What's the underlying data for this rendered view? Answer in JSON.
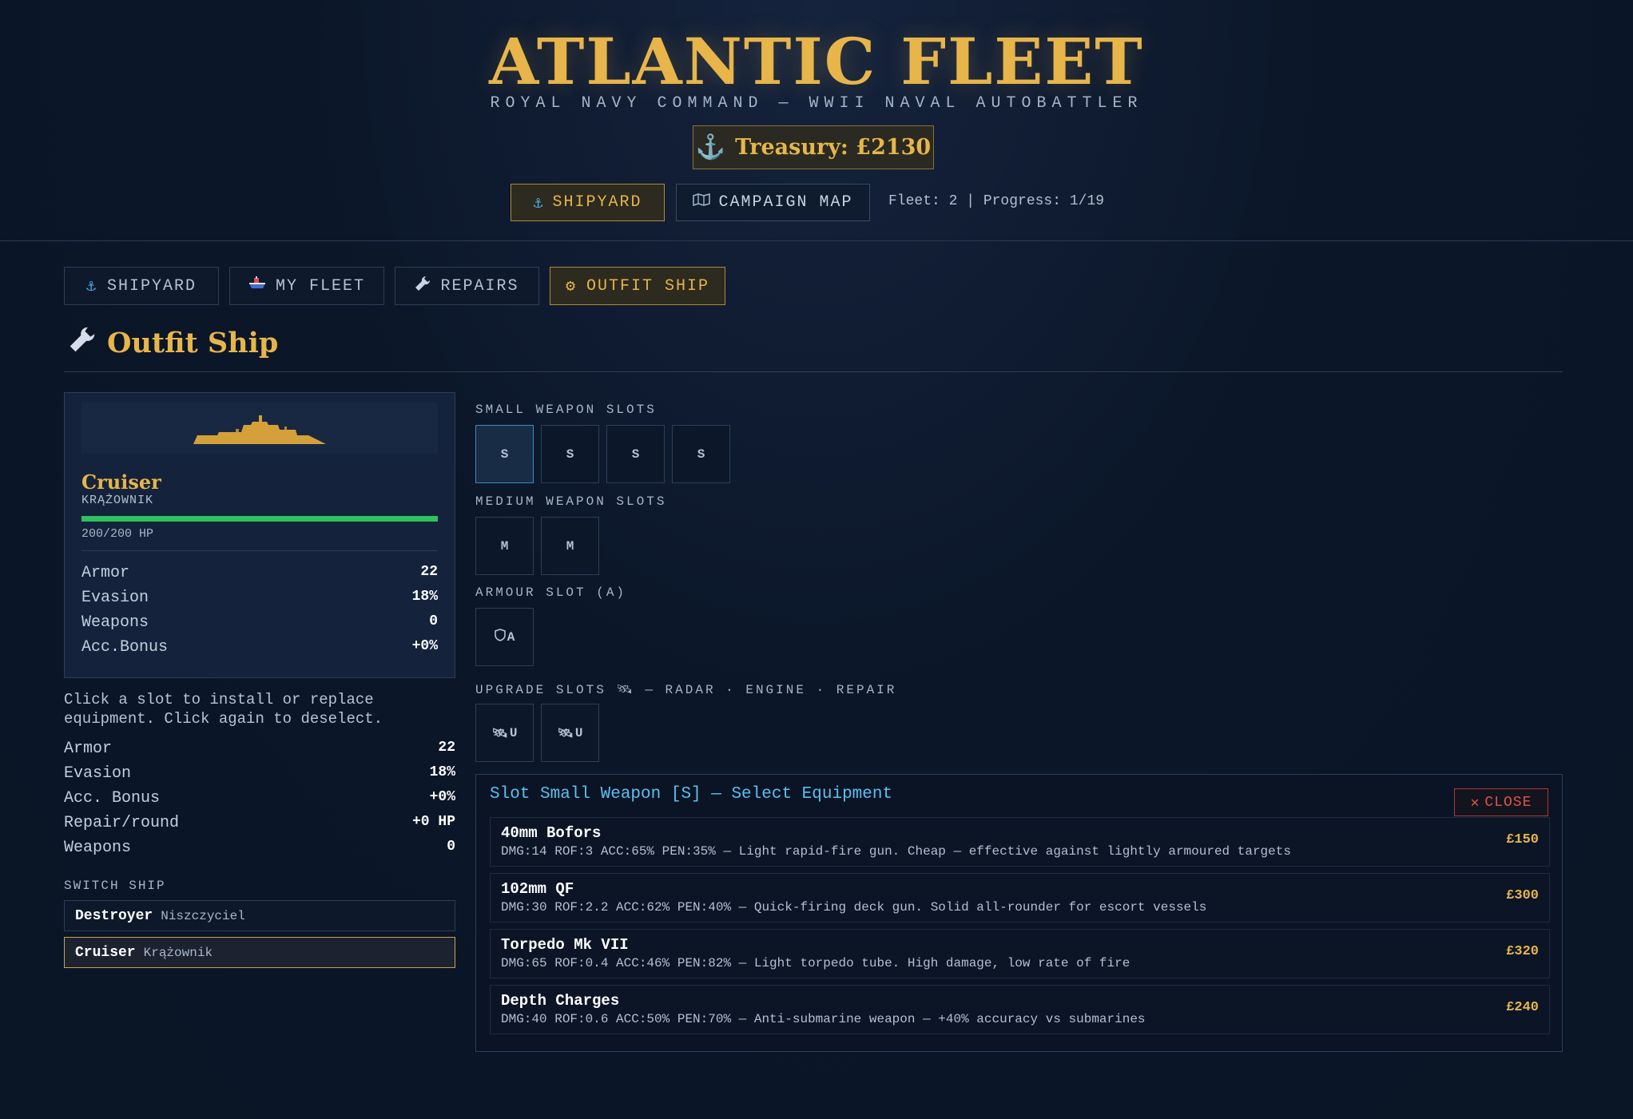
{
  "header": {
    "title": "ATLANTIC FLEET",
    "subtitle": "ROYAL NAVY COMMAND — WWII NAVAL AUTOBATTLER",
    "treasury": "Treasury: £2130",
    "nav": [
      {
        "label": "SHIPYARD",
        "icon": "anchor-icon"
      },
      {
        "label": "CAMPAIGN MAP",
        "icon": "map-icon"
      }
    ],
    "fleet_info": "Fleet: 2 | Progress: 1/19"
  },
  "tabs": [
    {
      "label": "SHIPYARD",
      "icon": "anchor-icon"
    },
    {
      "label": "MY FLEET",
      "icon": "ship-icon"
    },
    {
      "label": "REPAIRS",
      "icon": "wrench-icon"
    },
    {
      "label": "OUTFIT SHIP",
      "icon": "gear-icon"
    }
  ],
  "section": {
    "title": "Outfit Ship",
    "icon": "wrench-icon"
  },
  "ship": {
    "name": "Cruiser",
    "subname": "KRĄŻOWNIK",
    "hp_text": "200/200 HP",
    "hp_fraction": 1.0,
    "stats": [
      {
        "label": "Armor",
        "value": "22"
      },
      {
        "label": "Evasion",
        "value": "18%"
      },
      {
        "label": "Weapons",
        "value": "0"
      },
      {
        "label": "Acc.Bonus",
        "value": "+0%"
      }
    ]
  },
  "hint": "Click a slot to install or replace equipment. Click again to deselect.",
  "summary": [
    {
      "label": "Armor",
      "value": "22"
    },
    {
      "label": "Evasion",
      "value": "18%"
    },
    {
      "label": "Acc. Bonus",
      "value": "+0%"
    },
    {
      "label": "Repair/round",
      "value": "+0 HP"
    },
    {
      "label": "Weapons",
      "value": "0"
    }
  ],
  "switch_ship": {
    "label": "SWITCH SHIP",
    "items": [
      {
        "name": "Destroyer",
        "pl": "Niszczyciel"
      },
      {
        "name": "Cruiser",
        "pl": "Krążownik"
      }
    ]
  },
  "slots": {
    "small_label": "SMALL WEAPON SLOTS",
    "small": [
      "S",
      "S",
      "S",
      "S"
    ],
    "medium_label": "MEDIUM WEAPON SLOTS",
    "medium": [
      "M",
      "M"
    ],
    "armour_label": "ARMOUR SLOT (A)",
    "armour": [
      "A"
    ],
    "upgrade_label": "UPGRADE SLOTS 🛰 — RADAR · ENGINE · REPAIR",
    "upgrade": [
      "U",
      "U"
    ]
  },
  "equipment": {
    "title": "Slot Small Weapon [S] — Select Equipment",
    "close_label": "CLOSE",
    "items": [
      {
        "name": "40mm Bofors",
        "desc": "DMG:14 ROF:3 ACC:65% PEN:35% — Light rapid-fire gun. Cheap — effective against lightly armoured targets",
        "price": "£150"
      },
      {
        "name": "102mm QF",
        "desc": "DMG:30 ROF:2.2 ACC:62% PEN:40% — Quick-firing deck gun. Solid all-rounder for escort vessels",
        "price": "£300"
      },
      {
        "name": "Torpedo Mk VII",
        "desc": "DMG:65 ROF:0.4 ACC:46% PEN:82% — Light torpedo tube. High damage, low rate of fire",
        "price": "£320"
      },
      {
        "name": "Depth Charges",
        "desc": "DMG:40 ROF:0.6 ACC:50% PEN:70% — Anti-submarine weapon — +40% accuracy vs submarines",
        "price": "£240"
      }
    ]
  },
  "colors": {
    "accent": "#e7b54a",
    "info": "#5cc0f0",
    "hp": "#2fc25f",
    "danger": "#e0524a"
  }
}
